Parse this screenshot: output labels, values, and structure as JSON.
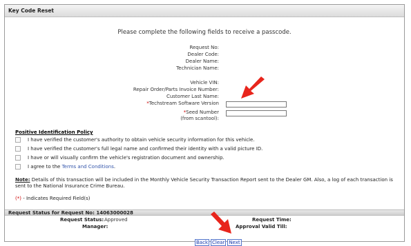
{
  "window": {
    "title": "Key Code Reset"
  },
  "intro": "Please complete the following fields to receive a passcode.",
  "request_fields": [
    "Request No:",
    "Dealer Code:",
    "Dealer Name:",
    "Technician Name:"
  ],
  "vehicle_fields": [
    "Vehicle VIN:",
    "Repair Order/Parts Invoice Number:",
    "Customer Last Name:"
  ],
  "techstream": {
    "asterisk": "*",
    "label": "Techstream Software Version",
    "value": ""
  },
  "seed": {
    "asterisk": "*",
    "label": "Seed Number",
    "sublabel": "(from scantool):",
    "value": ""
  },
  "policy": {
    "title": "Positive Identification Policy",
    "items": [
      "I have verified the customer's authority to obtain vehicle security information for this vehicle.",
      "I have verified the customer's full legal name and confirmed their identity with a valid picture ID.",
      "I have or will visually confirm the vehicle's registration document and ownership.",
      "I agree to the "
    ],
    "terms_link": "Terms and Conditions",
    "terms_end": "."
  },
  "note": {
    "label": "Note:",
    "text": " Details of this transaction will be included in the Monthly Vehicle Security Transaction Report sent to the Dealer GM. Also, a log of each transaction is sent to the National Insurance Crime Bureau."
  },
  "required_note": {
    "marker": "(*)",
    "text": " - Indicates Required Field(s)"
  },
  "status": {
    "header": "Request Status for Request No: 14063000028",
    "status_label": "Request Status:",
    "status_value": "Approved",
    "manager_label": "Manager:",
    "time_label": "Request Time:",
    "valid_label": "Approval Valid Till:"
  },
  "buttons": {
    "back": "Back",
    "clear": "Clear",
    "next": "Next"
  },
  "colors": {
    "arrow": "#e8251c",
    "required": "#cc0000",
    "link": "#3355aa"
  }
}
